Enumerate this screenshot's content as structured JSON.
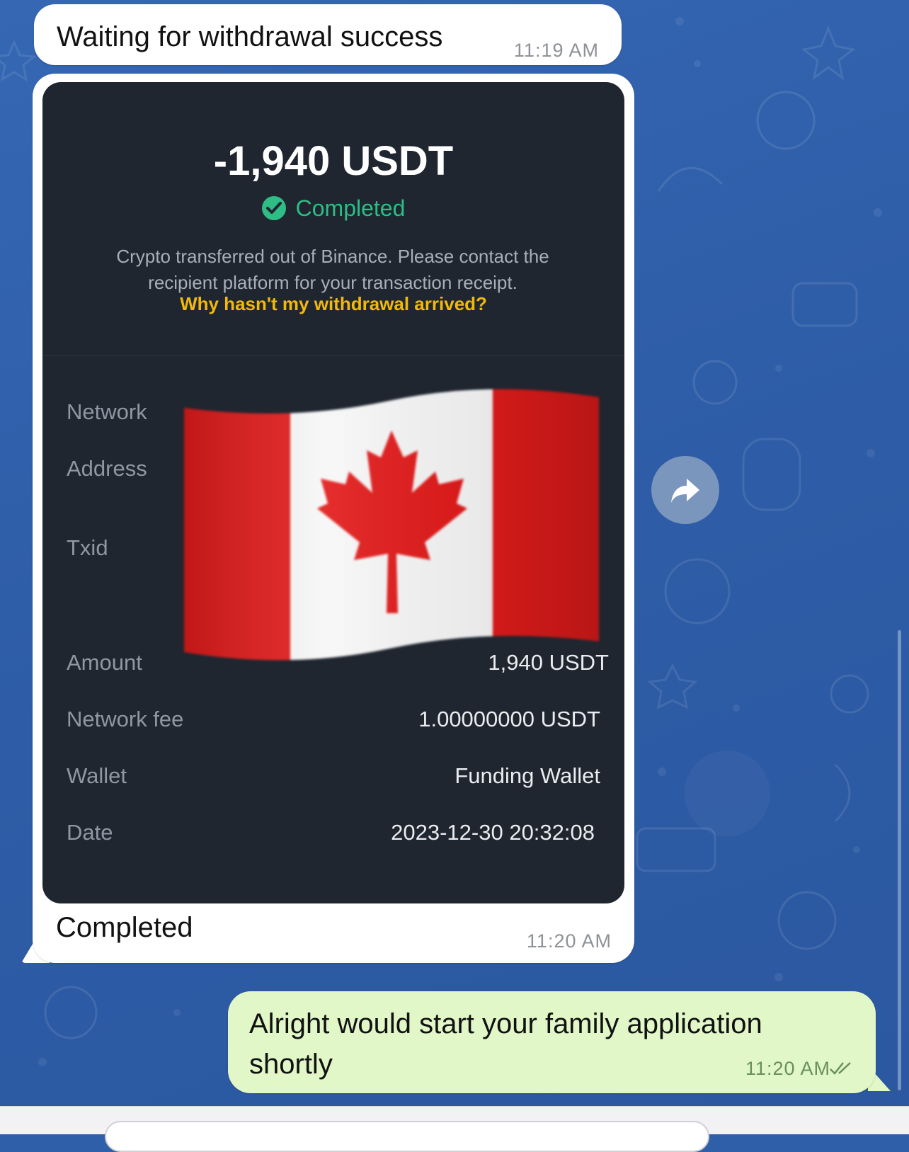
{
  "messages": [
    {
      "text": "Waiting for withdrawal success",
      "time": "11:19 AM"
    },
    {
      "caption": "Completed",
      "time": "11:20 AM"
    },
    {
      "text": "Alright would start your family application shortly",
      "time": "11:20 AM"
    }
  ],
  "receipt": {
    "amount": "-1,940 USDT",
    "status": "Completed",
    "description": "Crypto transferred out of Binance. Please contact the recipient platform for your transaction receipt.",
    "help_link": "Why hasn't my withdrawal arrived?",
    "rows": [
      {
        "label": "Network",
        "value": ""
      },
      {
        "label": "Address",
        "value": ""
      },
      {
        "label": "Txid",
        "value": ""
      },
      {
        "label": "Amount",
        "value": "1,940 USDT"
      },
      {
        "label": "Network fee",
        "value": "1.00000000 USDT"
      },
      {
        "label": "Wallet",
        "value": "Funding Wallet"
      },
      {
        "label": "Date",
        "value": "2023-12-30 20:32:08"
      }
    ]
  },
  "colors": {
    "chat_background": "#2f5fa8",
    "incoming_bubble": "#ffffff",
    "outgoing_bubble": "#e1f7c8",
    "receipt_background": "#1f2630",
    "status_green": "#2ebd85",
    "link_yellow": "#f0b90b"
  },
  "icons": {
    "forward": "forward-arrow-icon",
    "status": "check-circle-icon",
    "read_receipt": "double-check-icon",
    "overlay": "canada-flag-emoji"
  }
}
